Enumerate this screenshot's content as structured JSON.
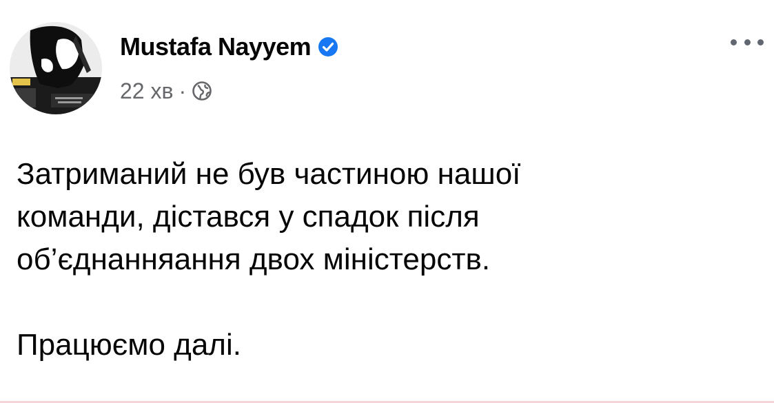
{
  "post": {
    "author_name": "Mustafa Nayyem",
    "verified": true,
    "timestamp": "22 хв",
    "separator": "·",
    "audience_icon": "globe-icon",
    "more_icon": "more-options-icon",
    "avatar": {
      "icon": "profile-avatar"
    },
    "text_lines": [
      "Затриманий не був частиною нашої",
      "команди, дістався у спадок після",
      "об’єднанняання двох міністерств."
    ],
    "closing_line": "Працюємо далі."
  },
  "colors": {
    "background": "#ffffff",
    "text": "#050505",
    "secondary_text": "#65676b",
    "verified_blue": "#1877f2",
    "divider": "#f4d6da"
  }
}
